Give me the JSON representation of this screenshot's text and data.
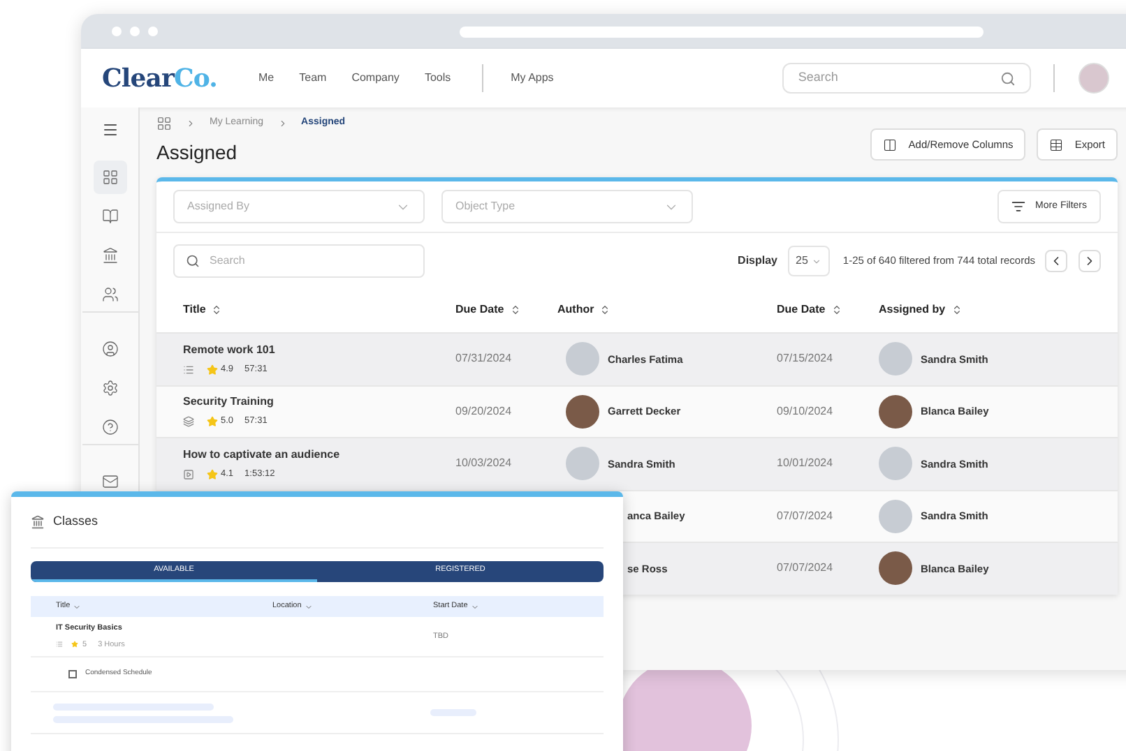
{
  "header": {
    "logo": {
      "part_1": "Clear",
      "part_2": "Co."
    },
    "nav": [
      "Me",
      "Team",
      "Company",
      "Tools"
    ],
    "apps_link": "My Apps",
    "search": {
      "placeholder": "Search"
    }
  },
  "sidebar": {
    "items": [
      {
        "selected": true
      },
      {
        "selected": false
      },
      {
        "selected": false
      },
      {
        "selected": false
      },
      {
        "selected": false
      },
      {
        "selected": false
      },
      {
        "selected": false
      },
      {
        "selected": false
      }
    ]
  },
  "breadcrumb": [
    {
      "label": "My Learning",
      "selected": false
    },
    {
      "label": "Assigned",
      "selected": true
    }
  ],
  "page_title": "Assigned",
  "actions": [
    "Add/Remove Columns",
    "Export"
  ],
  "filters": [
    {
      "placeholder": "Assigned By"
    },
    {
      "placeholder": "Object Type"
    }
  ],
  "more_filters": "More Filters",
  "table_search": {
    "placeholder": "Search"
  },
  "display": {
    "label": "Display",
    "value": "25"
  },
  "records": "1-25 of 640 filtered from 744 total records",
  "table": {
    "columns": [
      "Title",
      "Due Date",
      "Author",
      "Due Date",
      "Assigned by"
    ],
    "rows": [
      {
        "title": "Remote work 101",
        "rating": "4.9",
        "duration": "57:31",
        "due_date": "07/31/2024",
        "author": "Charles Fatima",
        "assigned_date": "07/15/2024",
        "assigned_by": "Sandra Smith"
      },
      {
        "title": "Security Training",
        "rating": "5.0",
        "duration": "57:31",
        "due_date": "09/20/2024",
        "author": "Garrett Decker",
        "assigned_date": "09/10/2024",
        "assigned_by": "Blanca Bailey"
      },
      {
        "title": "How to captivate an audience",
        "rating": "4.1",
        "duration": "1:53:12",
        "due_date": "10/03/2024",
        "author": "Sandra Smith",
        "assigned_date": "10/01/2024",
        "assigned_by": "Sandra Smith"
      },
      {
        "author": "anca Bailey",
        "assigned_date": "07/07/2024",
        "assigned_by": "Sandra Smith"
      },
      {
        "author": "se Ross",
        "assigned_date": "07/07/2024",
        "assigned_by": "Blanca Bailey"
      }
    ]
  },
  "classes_panel": {
    "title": "Classes",
    "tabs": [
      {
        "label": "AVAILABLE",
        "selected": true
      },
      {
        "label": "REGISTERED",
        "selected": false
      }
    ],
    "columns": [
      "Title",
      "Location",
      "Start Date"
    ],
    "rows": [
      {
        "title": "IT Security Basics",
        "rating": "5",
        "duration": "3 Hours",
        "start_date": "TBD"
      }
    ],
    "option": {
      "label": "Condensed Schedule",
      "checked": false
    }
  }
}
